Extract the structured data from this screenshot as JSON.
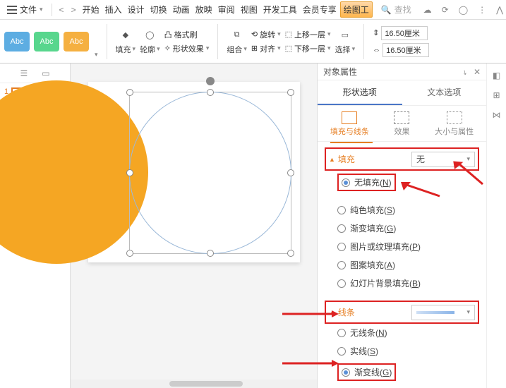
{
  "menubar": {
    "file": "文件",
    "items": [
      "开始",
      "插入",
      "设计",
      "切换",
      "动画",
      "放映",
      "审阅",
      "视图",
      "开发工具",
      "会员专享",
      "绘图工"
    ],
    "search_placeholder": "查找"
  },
  "ribbon": {
    "swatch_label": "Abc",
    "fill": "填充",
    "outline": "轮廓",
    "format_painter": "格式刷",
    "shape_effects": "形状效果",
    "group": "组合",
    "rotate": "旋转",
    "align": "对齐",
    "bring_forward": "上移一层",
    "send_backward": "下移一层",
    "select": "选择",
    "dim1": "16.50厘米",
    "dim2": "16.50厘米"
  },
  "slides": {
    "num": "1"
  },
  "panel": {
    "title": "对象属性",
    "tab_shape": "形状选项",
    "tab_text": "文本选项",
    "sub_fill": "填充与线条",
    "sub_effect": "效果",
    "sub_size": "大小与属性",
    "fill_section": "填充",
    "fill_none_combo": "无",
    "fill_options": {
      "none": "无填充(N)",
      "solid": "纯色填充(S)",
      "gradient": "渐变填充(G)",
      "picture": "图片或纹理填充(P)",
      "pattern": "图案填充(A)",
      "slidebg": "幻灯片背景填充(B)"
    },
    "line_section": "线条",
    "line_options": {
      "none": "无线条(N)",
      "solid": "实线(S)",
      "gradient": "渐变线(G)"
    }
  }
}
